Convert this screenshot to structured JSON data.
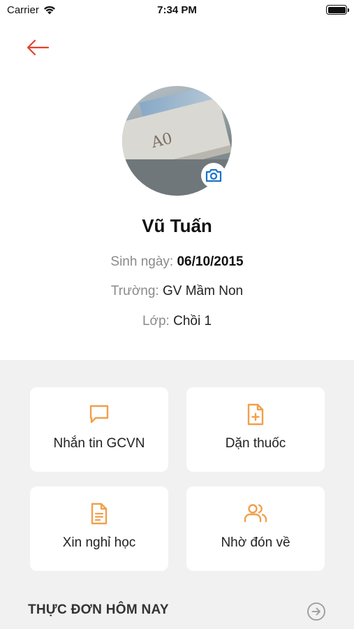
{
  "status_bar": {
    "carrier": "Carrier",
    "time": "7:34 PM"
  },
  "profile": {
    "name": "Vũ Tuấn",
    "dob_label": "Sinh ngày: ",
    "dob_value": "06/10/2015",
    "school_label": "Trường: ",
    "school_value": "GV Mầm Non",
    "class_label": "Lớp: ",
    "class_value": "Chồi 1"
  },
  "actions": [
    {
      "label": "Nhắn tin GCVN",
      "icon": "message-icon"
    },
    {
      "label": "Dặn thuốc",
      "icon": "medicine-file-icon"
    },
    {
      "label": "Xin nghỉ học",
      "icon": "document-icon"
    },
    {
      "label": "Nhờ đón về",
      "icon": "users-icon"
    }
  ],
  "menu_section": {
    "title": "THỰC ĐƠN HÔM NAY"
  },
  "colors": {
    "accent": "#f0a04b",
    "back_arrow": "#e8412c",
    "camera": "#1a73c9",
    "section_bg": "#f1f1f1"
  }
}
